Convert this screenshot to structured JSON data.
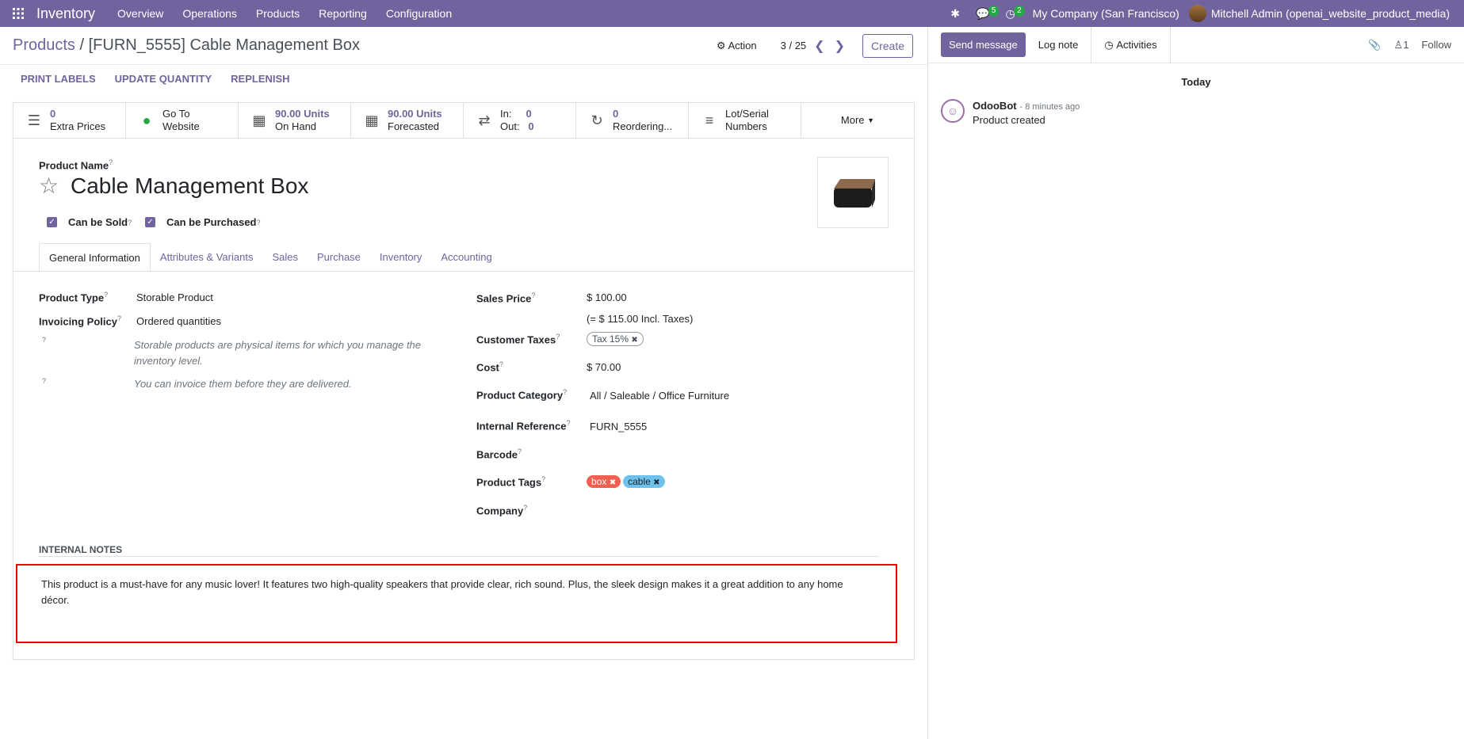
{
  "topbar": {
    "app_name": "Inventory",
    "menu": [
      "Overview",
      "Operations",
      "Products",
      "Reporting",
      "Configuration"
    ],
    "messages_badge": "5",
    "activities_badge": "2",
    "company": "My Company (San Francisco)",
    "user": "Mitchell Admin (openai_website_product_media)"
  },
  "control": {
    "breadcrumb_root": "Products",
    "breadcrumb_sep": " / ",
    "breadcrumb_current": "[FURN_5555] Cable Management Box",
    "action": "Action",
    "pager": "3 / 25",
    "create": "Create"
  },
  "statusbar": {
    "buttons": [
      "PRINT LABELS",
      "UPDATE QUANTITY",
      "REPLENISH"
    ]
  },
  "stats": {
    "extra_prices": {
      "num": "0",
      "label": "Extra Prices"
    },
    "website": {
      "l1": "Go To",
      "l2": "Website"
    },
    "on_hand": {
      "num": "90.00 Units",
      "label": "On Hand"
    },
    "forecasted": {
      "num": "90.00 Units",
      "label": "Forecasted"
    },
    "inout": {
      "in_label": "In:",
      "in_val": "0",
      "out_label": "Out:",
      "out_val": "0"
    },
    "reordering": {
      "num": "0",
      "label": "Reordering..."
    },
    "lots": {
      "l1": "Lot/Serial",
      "l2": "Numbers"
    },
    "more": "More"
  },
  "form": {
    "product_name_label": "Product Name",
    "product_name": "Cable Management Box",
    "can_be_sold": "Can be Sold",
    "can_be_purchased": "Can be Purchased"
  },
  "tabs": [
    "General Information",
    "Attributes & Variants",
    "Sales",
    "Purchase",
    "Inventory",
    "Accounting"
  ],
  "general": {
    "product_type_label": "Product Type",
    "product_type": "Storable Product",
    "invoicing_label": "Invoicing Policy",
    "invoicing": "Ordered quantities",
    "help1": "Storable products are physical items for which you manage the inventory level.",
    "help2": "You can invoice them before they are delivered.",
    "sales_price_label": "Sales Price",
    "sales_price": "$ 100.00",
    "incl_taxes": "(= $ 115.00 Incl. Taxes)",
    "customer_taxes_label": "Customer Taxes",
    "tax_tag": "Tax 15%",
    "cost_label": "Cost",
    "cost": "$ 70.00",
    "category_label": "Product Category",
    "category": "All / Saleable / Office Furniture",
    "ref_label": "Internal Reference",
    "ref": "FURN_5555",
    "barcode_label": "Barcode",
    "tags_label": "Product Tags",
    "tags": [
      "box",
      "cable"
    ],
    "company_label": "Company"
  },
  "notes": {
    "label": "INTERNAL NOTES",
    "text": "This product is a must-have for any music lover! It features two high-quality speakers that provide clear, rich sound. Plus, the sleek design makes it a great addition to any home décor."
  },
  "chatter": {
    "send": "Send message",
    "log": "Log note",
    "activities": "Activities",
    "followers": "1",
    "follow": "Follow",
    "today": "Today",
    "author": "OdooBot",
    "time": "- 8 minutes ago",
    "body": "Product created"
  },
  "colors": {
    "brand": "#71639e",
    "tag_box": "#f06050",
    "tag_cable": "#6cc1ed",
    "highlight": "#ee0000"
  }
}
